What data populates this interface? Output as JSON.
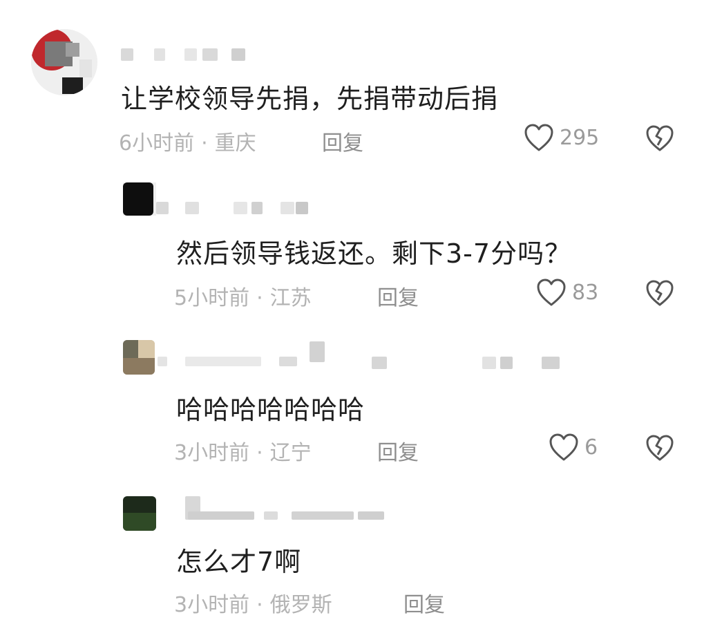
{
  "comments": [
    {
      "text": "让学校领导先捐，先捐带动后捐",
      "time": "6小时前",
      "location": "重庆",
      "reply_label": "回复",
      "likes": "295"
    },
    {
      "text": "然后领导钱返还。剩下3-7分吗？",
      "time": "5小时前",
      "location": "江苏",
      "reply_label": "回复",
      "likes": "83"
    },
    {
      "text": "哈哈哈哈哈哈哈",
      "time": "3小时前",
      "location": "辽宁",
      "reply_label": "回复",
      "likes": "6"
    },
    {
      "text": "怎么才7啊",
      "time": "3小时前",
      "location": "俄罗斯",
      "reply_label": "回复"
    }
  ],
  "separator": "·",
  "colors": {
    "text": "#1f1f1f",
    "meta": "#b3b3b3",
    "reply": "#8e8e8e",
    "icon": "#555555"
  },
  "icons": {
    "like": "heart-outline-icon",
    "dislike": "broken-heart-icon"
  }
}
